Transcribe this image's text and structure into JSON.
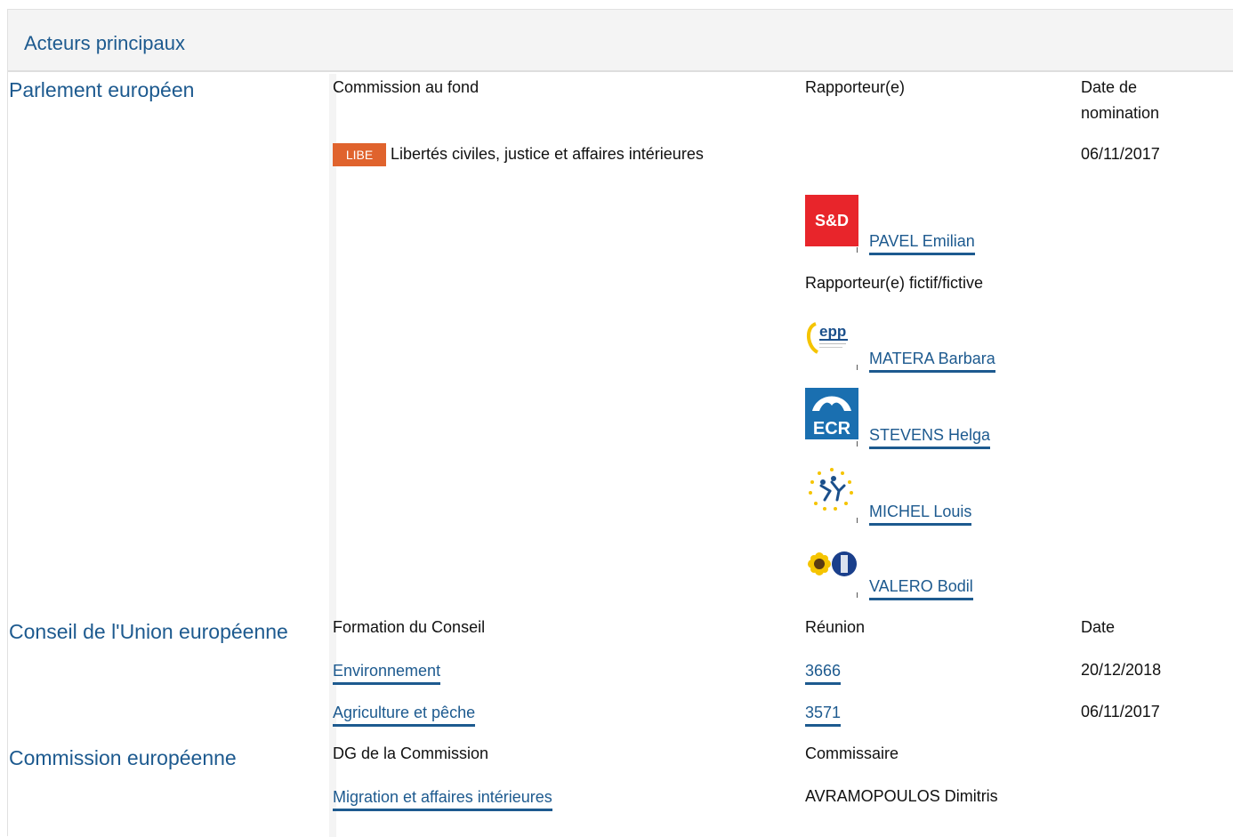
{
  "section": {
    "title": "Acteurs principaux"
  },
  "parliament": {
    "body": "Parlement européen",
    "header": {
      "committee": "Commission au fond",
      "rapporteur": "Rapporteur(e)",
      "date_line1": "Date de",
      "date_line2": "nomination"
    },
    "committee": {
      "code": "LIBE",
      "name": "Libertés civiles, justice et affaires intérieures",
      "date": "06/11/2017",
      "badge_color": "#e0632d"
    },
    "rapporteur": {
      "group": "S&D",
      "name": "PAVEL Emilian"
    },
    "shadow_label": "Rapporteur(e) fictif/fictive",
    "shadows": [
      {
        "group": "epp",
        "name": "MATERA Barbara"
      },
      {
        "group": "ECR",
        "name": "STEVENS Helga"
      },
      {
        "group": "EFDD",
        "name": "MICHEL Louis"
      },
      {
        "group": "Verts/ALE",
        "name": "VALERO Bodil"
      }
    ]
  },
  "council": {
    "body": "Conseil de l'Union européenne",
    "header": {
      "formation": "Formation du Conseil",
      "meeting": "Réunion",
      "date": "Date"
    },
    "rows": [
      {
        "formation": "Environnement",
        "meeting": "3666",
        "date": "20/12/2018"
      },
      {
        "formation": "Agriculture et pêche",
        "meeting": "3571",
        "date": "06/11/2017"
      }
    ]
  },
  "commission": {
    "body": "Commission européenne",
    "header": {
      "dg": "DG de la Commission",
      "commissioner": "Commissaire"
    },
    "dg": "Migration et affaires intérieures",
    "commissioner": "AVRAMOPOULOS Dimitris"
  },
  "colors": {
    "link": "#1d5a8f",
    "header_bg": "#f4f4f4",
    "sd_red": "#e8252b",
    "ecr_blue": "#1a6fb0"
  }
}
